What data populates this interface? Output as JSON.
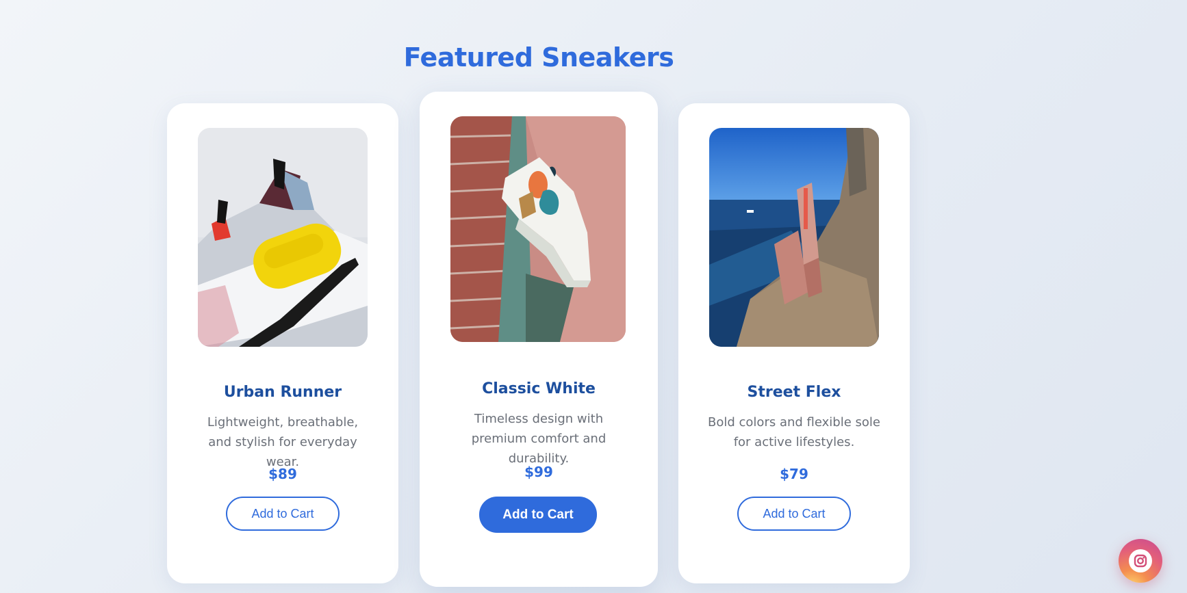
{
  "page": {
    "title": "Featured Sneakers"
  },
  "products": [
    {
      "name": "Urban Runner",
      "description": "Lightweight, breathable, and stylish for everyday wear.",
      "price": "$89",
      "button_label": "Add to Cart",
      "featured": false
    },
    {
      "name": "Classic White",
      "description": "Timeless design with premium comfort and durability.",
      "price": "$99",
      "button_label": "Add to Cart",
      "featured": true
    },
    {
      "name": "Street Flex",
      "description": "Bold colors and flexible sole for active lifestyles.",
      "price": "$79",
      "button_label": "Add to Cart",
      "featured": false
    }
  ],
  "floating_button": {
    "icon": "instagram-icon"
  },
  "colors": {
    "accent": "#2f6bdc",
    "product_name": "#1d4f9e",
    "description": "#6a6f78"
  }
}
